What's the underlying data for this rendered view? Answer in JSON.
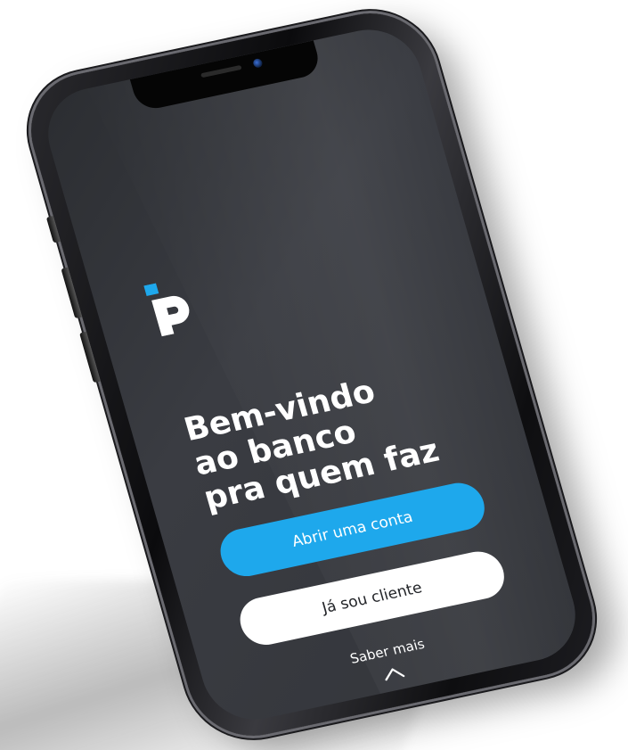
{
  "brand": {
    "logo_icon": "pagbank-p-logo-icon",
    "accent_color": "#1ea8ec"
  },
  "welcome": {
    "headline_lines": [
      "Bem-vindo",
      "ao banco",
      "pra quem faz"
    ]
  },
  "actions": {
    "open_account_label": "Abrir uma conta",
    "existing_client_label": "Já sou cliente"
  },
  "footer": {
    "learn_more_label": "Saber mais",
    "learn_more_icon": "chevron-up-icon"
  },
  "colors": {
    "screen_background": "#33353a",
    "primary_button": "#1ea8ec",
    "secondary_button": "#ffffff",
    "text": "#ffffff"
  }
}
